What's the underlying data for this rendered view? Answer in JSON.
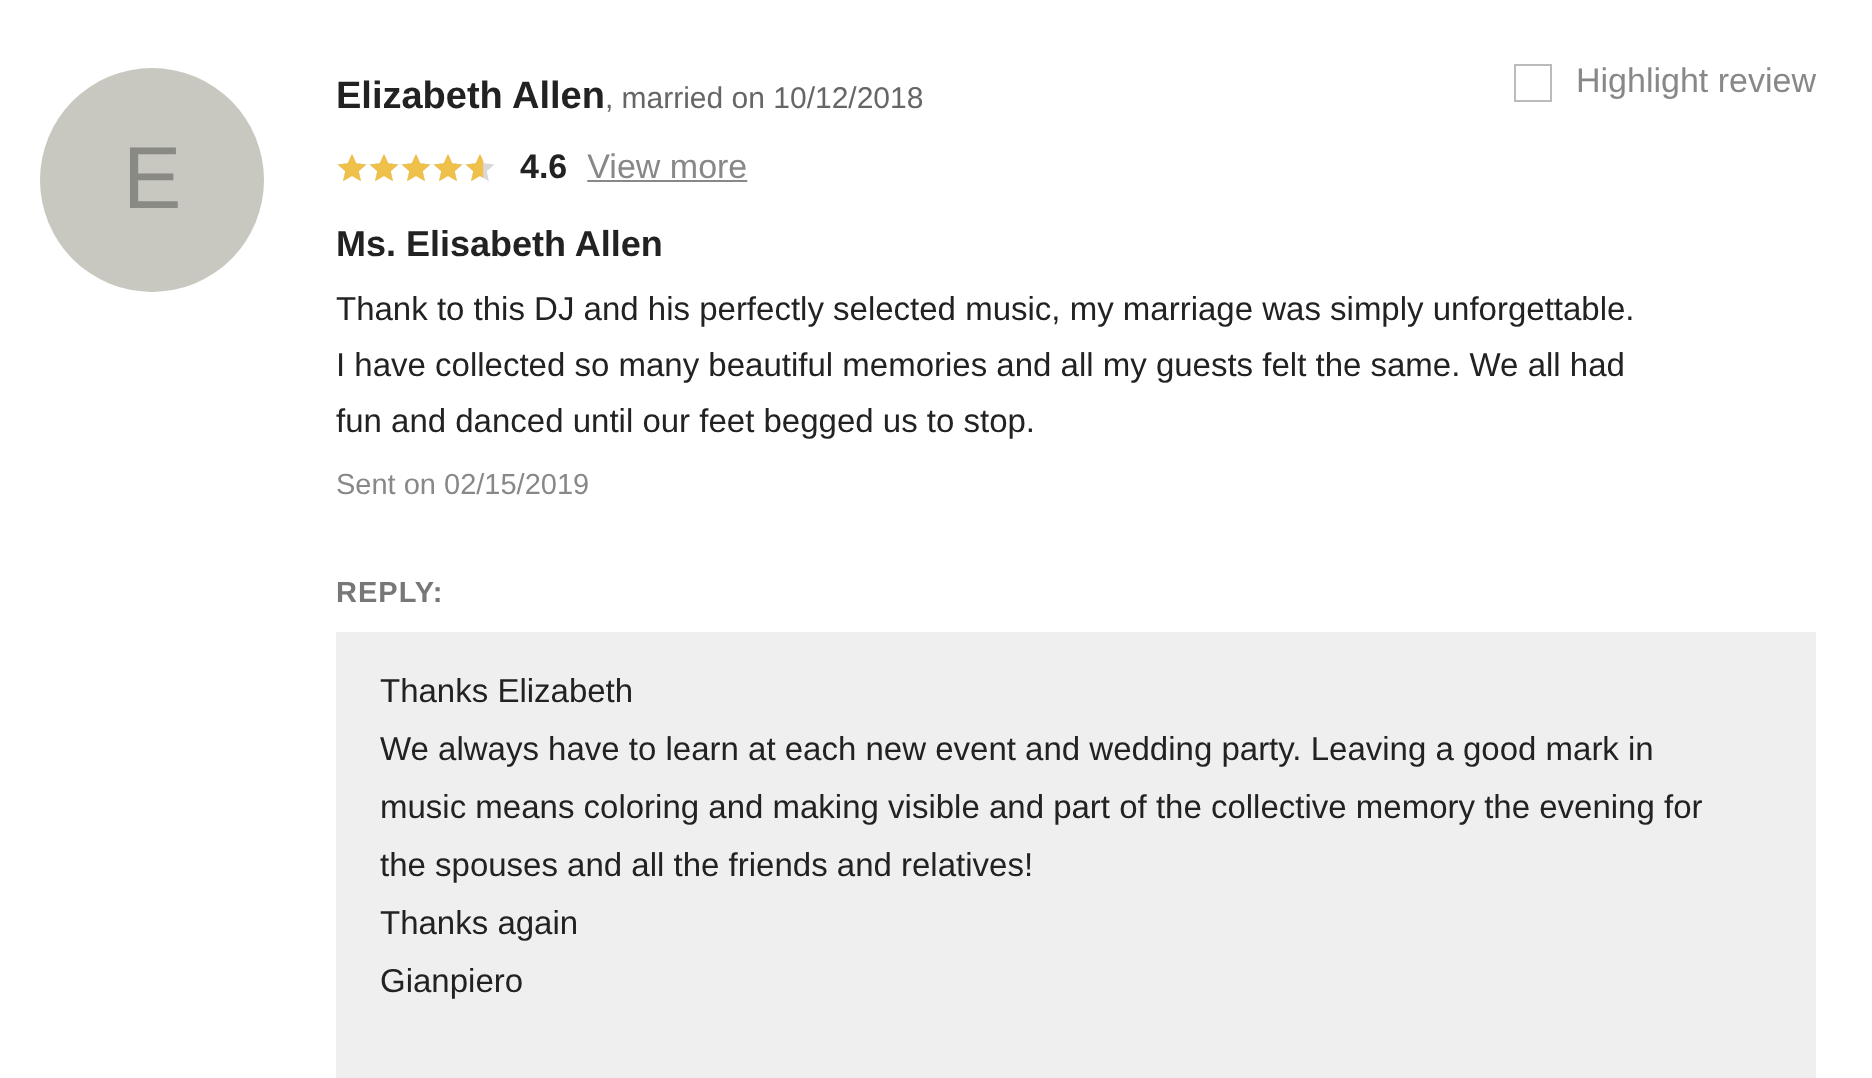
{
  "avatar": {
    "initial": "E"
  },
  "reviewer": {
    "name": "Elizabeth Allen",
    "married": ", married on 10/12/2018"
  },
  "rating": {
    "stars": 4.6,
    "score": "4.6",
    "link": "View more"
  },
  "highlight": {
    "label": "Highlight review",
    "checked": false
  },
  "review": {
    "title": "Ms. Elisabeth Allen",
    "body": "Thank to this DJ and his perfectly selected music, my marriage was simply unforgettable. I have collected so many beautiful memories and all my guests felt the same. We all had fun and danced until our feet begged us to stop.",
    "sent": "Sent on 02/15/2019"
  },
  "reply": {
    "label": "REPLY:",
    "lines": [
      "Thanks Elizabeth",
      "We always have to learn at each new event and wedding party. Leaving a good mark in music means coloring and making visible and part of the collective memory the evening for the spouses and all the friends and relatives!",
      "Thanks again",
      "Gianpiero"
    ]
  }
}
